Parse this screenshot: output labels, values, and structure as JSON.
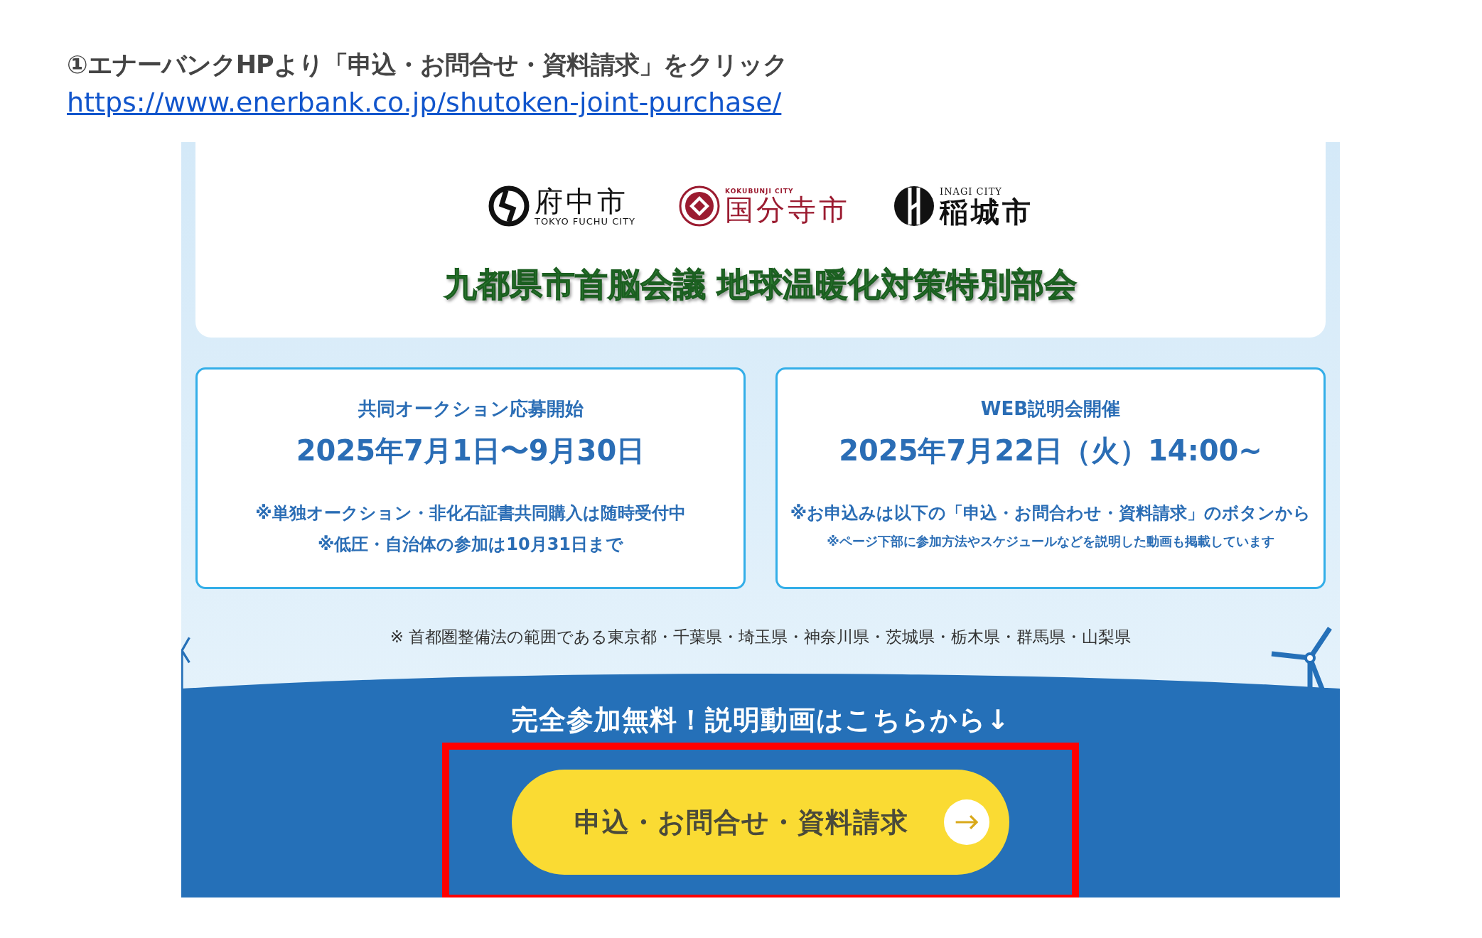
{
  "instruction": {
    "heading": "①エナーバンクHPより「申込・お問合せ・資料請求」をクリック",
    "link": "https://www.enerbank.co.jp/shutoken-joint-purchase/"
  },
  "page": {
    "logos": [
      {
        "kind": "fuchu",
        "name": "府中市",
        "sub": "TOKYO FUCHU CITY"
      },
      {
        "kind": "kokubunji",
        "name": "国分寺市",
        "sub": "KOKUBUNJI CITY"
      },
      {
        "kind": "inagi",
        "name": "稲城市",
        "sub": "INAGI CITY"
      }
    ],
    "council": "九都県市首脳会議 地球温暖化対策特別部会",
    "cards": [
      {
        "title": "共同オークション応募開始",
        "date": "2025年7月1日〜9月30日",
        "notes": [
          {
            "kind": "note",
            "text": "※単独オークション・非化石証書共同購入は随時受付中"
          },
          {
            "kind": "note",
            "text": "※低圧・自治体の参加は10月31日まで"
          }
        ]
      },
      {
        "title": "WEB説明会開催",
        "date": "2025年7月22日（火）14:00~",
        "notes": [
          {
            "kind": "note",
            "text": "※お申込みは以下の「申込・お問合わせ・資料請求」のボタンから"
          },
          {
            "kind": "fine",
            "text": "※ページ下部に参加方法やスケジュールなどを説明した動画も掲載しています"
          }
        ]
      }
    ],
    "area_note": "※ 首都圏整備法の範囲である東京都・千葉県・埼玉県・神奈川県・茨城県・栃木県・群馬県・山梨県",
    "cta_heading": "完全参加無料！説明動画はこちらから↓",
    "button": {
      "label": "申込・お問合せ・資料請求",
      "highlighted": true
    }
  }
}
